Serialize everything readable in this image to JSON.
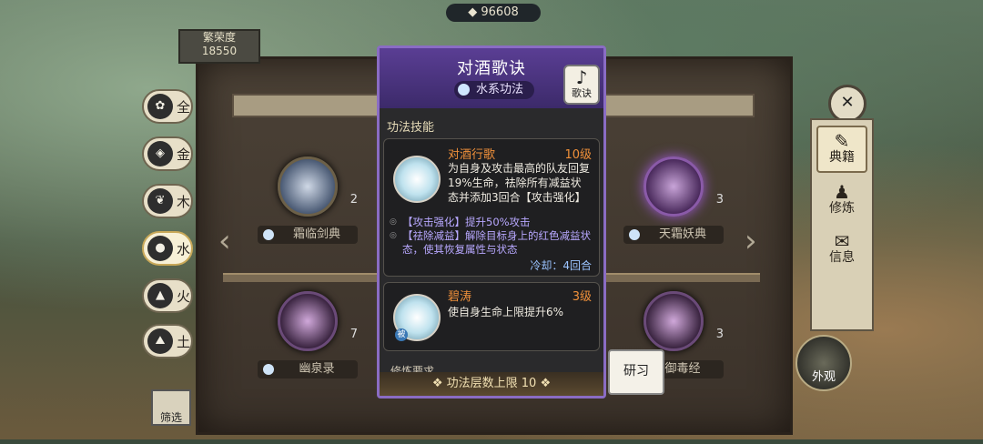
{
  "top": {
    "resource": "96608"
  },
  "reputation": {
    "label": "繁荣度",
    "value": "18550"
  },
  "elements": [
    {
      "label": "全",
      "icon": "all-icon"
    },
    {
      "label": "金",
      "icon": "metal-icon"
    },
    {
      "label": "木",
      "icon": "wood-icon"
    },
    {
      "label": "水",
      "icon": "water-icon"
    },
    {
      "label": "火",
      "icon": "fire-icon"
    },
    {
      "label": "土",
      "icon": "earth-icon"
    }
  ],
  "filter_label": "筛选",
  "books": [
    {
      "name": "霜临剑典",
      "level": "2"
    },
    {
      "name": "天霜妖典",
      "level": "3"
    },
    {
      "name": "幽泉录",
      "level": "7"
    },
    {
      "name": "御毒经",
      "level": "3"
    }
  ],
  "side_tabs": [
    {
      "label": "典籍"
    },
    {
      "label": "修炼"
    },
    {
      "label": "信息"
    }
  ],
  "appearance_label": "外观",
  "dialog": {
    "title": "对酒歌诀",
    "element": "水系功法",
    "badge_label": "歌诀",
    "section_title": "功法技能",
    "skills": [
      {
        "name": "对酒行歌",
        "level": "10级",
        "desc": "为自身及攻击最高的队友回复19%生命，祛除所有减益状态并添加3回合【攻击强化】",
        "effects": [
          "【攻击强化】提升50%攻击",
          "【祛除减益】解除目标身上的红色减益状态，使其恢复属性与状态"
        ],
        "cooldown": "冷却：4回合"
      },
      {
        "name": "碧涛",
        "level": "3级",
        "desc": "使自身生命上限提升6%",
        "tag": "被"
      }
    ],
    "next_section": "修炼要求",
    "footer": "功法层数上限 10"
  },
  "study_label": "研习"
}
